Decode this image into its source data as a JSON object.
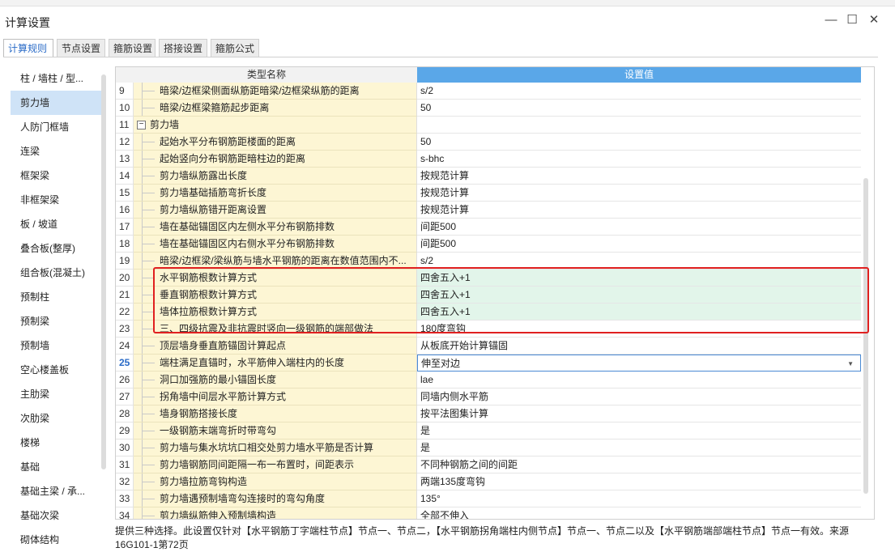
{
  "window": {
    "title": "计算设置"
  },
  "tabs": [
    {
      "label": "计算规则",
      "active": true
    },
    {
      "label": "节点设置",
      "active": false
    },
    {
      "label": "箍筋设置",
      "active": false
    },
    {
      "label": "搭接设置",
      "active": false
    },
    {
      "label": "箍筋公式",
      "active": false
    }
  ],
  "sidebar": {
    "items": [
      {
        "label": "柱 / 墙柱 / 型..."
      },
      {
        "label": "剪力墙",
        "active": true
      },
      {
        "label": "人防门框墙"
      },
      {
        "label": "连梁"
      },
      {
        "label": "框架梁"
      },
      {
        "label": "非框架梁"
      },
      {
        "label": "板 / 坡道"
      },
      {
        "label": "叠合板(整厚)"
      },
      {
        "label": "组合板(混凝土)"
      },
      {
        "label": "预制柱"
      },
      {
        "label": "预制梁"
      },
      {
        "label": "预制墙"
      },
      {
        "label": "空心楼盖板"
      },
      {
        "label": "主肋梁"
      },
      {
        "label": "次肋梁"
      },
      {
        "label": "楼梯"
      },
      {
        "label": "基础"
      },
      {
        "label": "基础主梁 / 承..."
      },
      {
        "label": "基础次梁"
      },
      {
        "label": "砌体结构"
      }
    ]
  },
  "grid": {
    "headers": {
      "name": "类型名称",
      "value": "设置值"
    },
    "rows": [
      {
        "num": "9",
        "name": "暗梁/边框梁侧面纵筋距暗梁/边框梁纵筋的距离",
        "value": "s/2"
      },
      {
        "num": "10",
        "name": "暗梁/边框梁箍筋起步距离",
        "value": "50"
      },
      {
        "num": "11",
        "name": "剪力墙",
        "value": "",
        "group": true
      },
      {
        "num": "12",
        "name": "起始水平分布钢筋距楼面的距离",
        "value": "50"
      },
      {
        "num": "13",
        "name": "起始竖向分布钢筋距暗柱边的距离",
        "value": "s-bhc"
      },
      {
        "num": "14",
        "name": "剪力墙纵筋露出长度",
        "value": "按规范计算"
      },
      {
        "num": "15",
        "name": "剪力墙基础插筋弯折长度",
        "value": "按规范计算"
      },
      {
        "num": "16",
        "name": "剪力墙纵筋错开距离设置",
        "value": "按规范计算"
      },
      {
        "num": "17",
        "name": "墙在基础锚固区内左侧水平分布钢筋排数",
        "value": "间距500"
      },
      {
        "num": "18",
        "name": "墙在基础锚固区内右侧水平分布钢筋排数",
        "value": "间距500"
      },
      {
        "num": "19",
        "name": "暗梁/边框梁/梁纵筋与墙水平钢筋的距离在数值范围内不...",
        "value": "s/2"
      },
      {
        "num": "20",
        "name": "水平钢筋根数计算方式",
        "value": "四舍五入+1",
        "highlight": true
      },
      {
        "num": "21",
        "name": "垂直钢筋根数计算方式",
        "value": "四舍五入+1",
        "highlight": true
      },
      {
        "num": "22",
        "name": "墙体拉筋根数计算方式",
        "value": "四舍五入+1",
        "highlight": true
      },
      {
        "num": "23",
        "name": "三、四级抗震及非抗震时竖向一级钢筋的端部做法",
        "value": "180度弯钩"
      },
      {
        "num": "24",
        "name": "顶层墙身垂直筋锚固计算起点",
        "value": "从板底开始计算锚固"
      },
      {
        "num": "25",
        "name": "端柱满足直锚时，水平筋伸入端柱内的长度",
        "value": "伸至对边",
        "selected": true
      },
      {
        "num": "26",
        "name": "洞口加强筋的最小锚固长度",
        "value": "lae"
      },
      {
        "num": "27",
        "name": "拐角墙中间层水平筋计算方式",
        "value": "同墙内侧水平筋"
      },
      {
        "num": "28",
        "name": "墙身钢筋搭接长度",
        "value": "按平法图集计算"
      },
      {
        "num": "29",
        "name": "一级钢筋末端弯折时带弯勾",
        "value": "是"
      },
      {
        "num": "30",
        "name": "剪力墙与集水坑坑口相交处剪力墙水平筋是否计算",
        "value": "是"
      },
      {
        "num": "31",
        "name": "剪力墙钢筋同间距隔一布一布置时，间距表示",
        "value": "不同种钢筋之间的间距"
      },
      {
        "num": "32",
        "name": "剪力墙拉筋弯钩构造",
        "value": "两端135度弯钩"
      },
      {
        "num": "33",
        "name": "剪力墙遇预制墙弯勾连接时的弯勾角度",
        "value": "135°"
      },
      {
        "num": "34",
        "name": "剪力墙纵筋伸入预制墙构造",
        "value": "全部不伸入"
      }
    ]
  },
  "footer": {
    "text": "提供三种选择。此设置仅针对【水平钢筋丁字端柱节点】节点一、节点二，【水平钢筋拐角端柱内侧节点】节点一、节点二以及【水平钢筋端部端柱节点】节点一有效。来源16G101-1第72页"
  },
  "colors": {
    "accent": "#5aa7e8",
    "highlight_row": "#e2f5ea",
    "annotation_box": "#e02020",
    "name_cell": "#fdf6d4"
  }
}
